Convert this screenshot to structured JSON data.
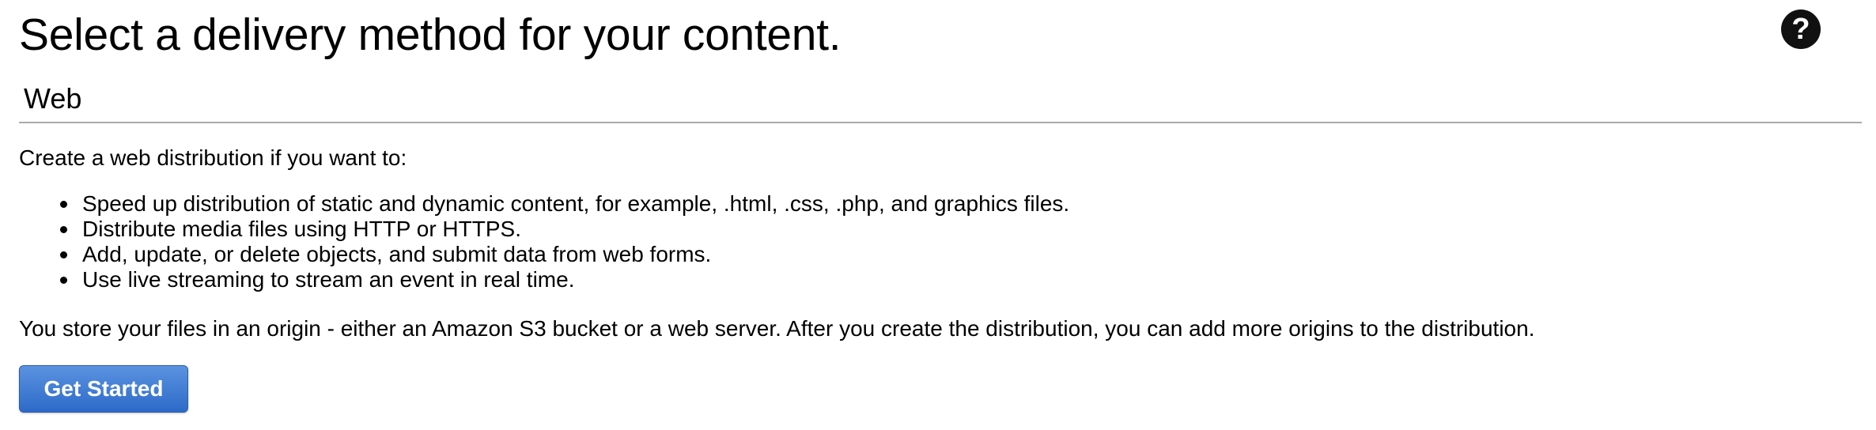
{
  "header": {
    "title": "Select a delivery method for your content.",
    "help_icon": "question-circle-icon",
    "help_glyph": "?"
  },
  "section": {
    "title": "Web",
    "intro": "Create a web distribution if you want to:",
    "bullets": [
      "Speed up distribution of static and dynamic content, for example, .html, .css, .php, and graphics files.",
      "Distribute media files using HTTP or HTTPS.",
      "Add, update, or delete objects, and submit data from web forms.",
      "Use live streaming to stream an event in real time."
    ],
    "origin_text": "You store your files in an origin - either an Amazon S3 bucket or a web server. After you create the distribution, you can add more origins to the distribution.",
    "button_label": "Get Started"
  },
  "colors": {
    "button_top": "#5b93e0",
    "button_bottom": "#2d6ac9",
    "divider": "#aaaaaa",
    "help_icon_bg": "#111111"
  }
}
